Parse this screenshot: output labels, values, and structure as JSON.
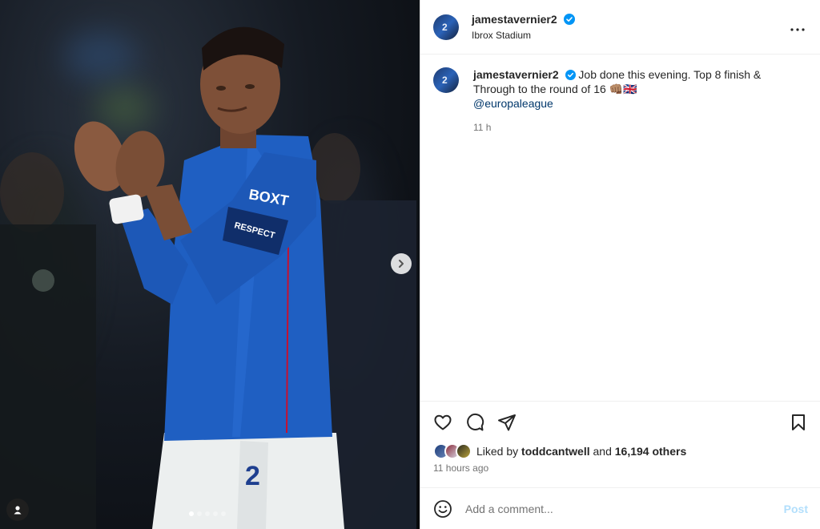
{
  "post": {
    "username": "jamestavernier2",
    "location": "Ibrox Stadium",
    "more_icon": "more-horizontal-icon",
    "caption_text": "Job done this evening. Top 8 finish & Through to the round of 16 👊🏽🇬🇧",
    "caption_mention": "@europaleague",
    "caption_time": "11 h",
    "liked_by_prefix": "Liked by",
    "liked_by_user": "toddcantwell",
    "liked_by_and": "and",
    "liked_by_others": "16,194 others",
    "posted_ago": "11 hours ago"
  },
  "media": {
    "carousel_count": 5,
    "carousel_active": 0
  },
  "comment": {
    "placeholder": "Add a comment...",
    "post_label": "Post"
  },
  "colors": {
    "verified": "#0095f6",
    "link": "#00376b",
    "post_disabled": "#b2dffc"
  }
}
